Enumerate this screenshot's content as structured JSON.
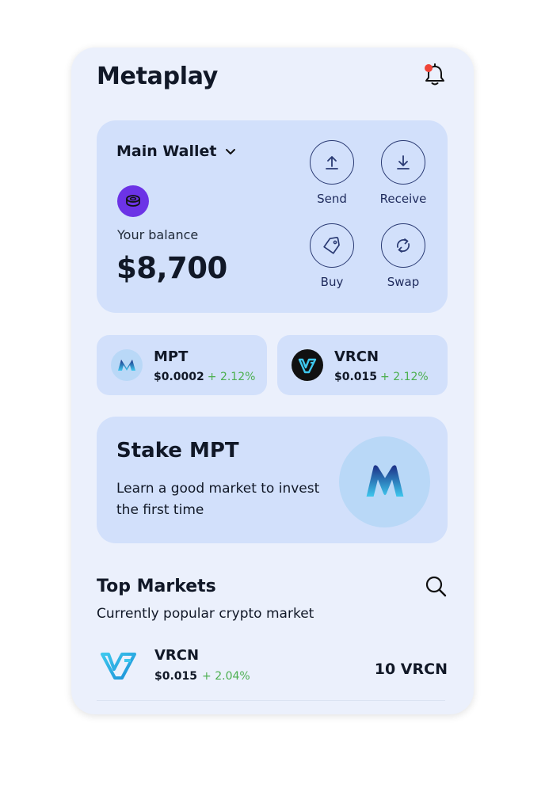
{
  "header": {
    "title": "Metaplay",
    "notification_icon": "bell-icon"
  },
  "wallet": {
    "name": "Main Wallet",
    "balance_label": "Your balance",
    "balance": "$8,700",
    "coin_icon": "coin-icon",
    "actions": [
      {
        "label": "Send",
        "icon": "upload-icon"
      },
      {
        "label": "Receive",
        "icon": "download-icon"
      },
      {
        "label": "Buy",
        "icon": "tag-icon"
      },
      {
        "label": "Swap",
        "icon": "swap-icon"
      }
    ]
  },
  "tokens": [
    {
      "symbol": "MPT",
      "price": "$0.0002",
      "change": "+ 2.12%"
    },
    {
      "symbol": "VRCN",
      "price": "$0.015",
      "change": "+ 2.12%"
    }
  ],
  "stake": {
    "title": "Stake MPT",
    "description": "Learn a good market to invest the first time"
  },
  "markets": {
    "title": "Top Markets",
    "subtitle": "Currently popular crypto market",
    "items": [
      {
        "symbol": "VRCN",
        "price": "$0.015",
        "change": "+ 2.04%",
        "amount": "10 VRCN"
      }
    ]
  },
  "colors": {
    "background": "#ebf0fc",
    "card": "#d2e0fb",
    "positive": "#4caf50",
    "accent_purple": "#6c33e6",
    "notification_dot": "#f04438"
  }
}
